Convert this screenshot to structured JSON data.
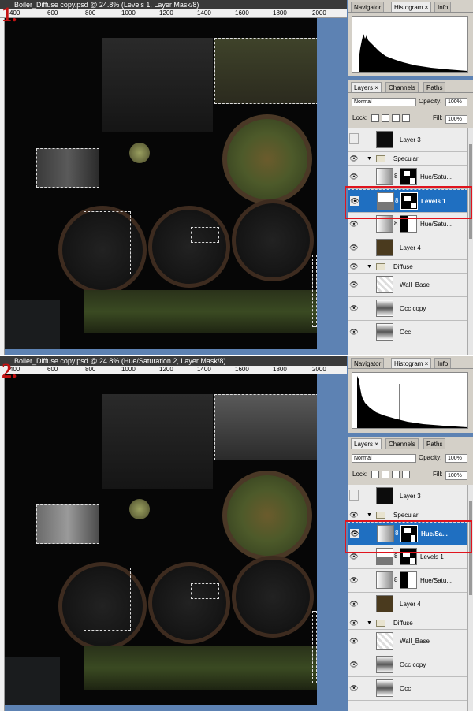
{
  "step1": {
    "number": "1.",
    "window_title": "Boiler_Diffuse copy.psd @ 24.8% (Levels 1, Layer Mask/8)",
    "ruler_labels": [
      "400",
      "600",
      "800",
      "1000",
      "1200",
      "1400",
      "1600",
      "1800",
      "2000"
    ],
    "panel_tabs": [
      "Navigator",
      "Histogram",
      "Info"
    ],
    "active_panel_tab": "Histogram",
    "layers_tabs": [
      "Layers",
      "Channels",
      "Paths"
    ],
    "blend_mode": "Normal",
    "opacity_label": "Opacity:",
    "opacity_value": "100%",
    "lock_label": "Lock:",
    "fill_label": "Fill:",
    "fill_value": "100%",
    "layers": [
      {
        "name": "Layer 3",
        "kind": "pixel",
        "visible": false
      },
      {
        "name": "Specular",
        "kind": "group",
        "visible": true
      },
      {
        "name": "Hue/Satu...",
        "kind": "adjust",
        "visible": true
      },
      {
        "name": "Levels 1",
        "kind": "adjust",
        "visible": true,
        "selected": true
      },
      {
        "name": "Hue/Satu...",
        "kind": "adjust",
        "visible": true
      },
      {
        "name": "Layer 4",
        "kind": "pixel",
        "visible": true
      },
      {
        "name": "Diffuse",
        "kind": "group",
        "visible": true
      },
      {
        "name": "Wall_Base",
        "kind": "pixel",
        "visible": true
      },
      {
        "name": "Occ copy",
        "kind": "pixel",
        "visible": true
      },
      {
        "name": "Occ",
        "kind": "pixel",
        "visible": true
      }
    ]
  },
  "step2": {
    "number": "2.",
    "window_title": "Boiler_Diffuse copy.psd @ 24.8% (Hue/Saturation 2, Layer Mask/8)",
    "ruler_labels": [
      "400",
      "600",
      "800",
      "1000",
      "1200",
      "1400",
      "1600",
      "1800",
      "2000"
    ],
    "panel_tabs": [
      "Navigator",
      "Histogram",
      "Info"
    ],
    "active_panel_tab": "Histogram",
    "layers_tabs": [
      "Layers",
      "Channels",
      "Paths"
    ],
    "blend_mode": "Normal",
    "opacity_label": "Opacity:",
    "opacity_value": "100%",
    "lock_label": "Lock:",
    "fill_label": "Fill:",
    "fill_value": "100%",
    "layers": [
      {
        "name": "Layer 3",
        "kind": "pixel",
        "visible": false
      },
      {
        "name": "Specular",
        "kind": "group",
        "visible": true
      },
      {
        "name": "Hue/Sa...",
        "kind": "adjust",
        "visible": true,
        "selected": true
      },
      {
        "name": "Levels 1",
        "kind": "adjust",
        "visible": true
      },
      {
        "name": "Hue/Satu...",
        "kind": "adjust",
        "visible": true
      },
      {
        "name": "Layer 4",
        "kind": "pixel",
        "visible": true
      },
      {
        "name": "Diffuse",
        "kind": "group",
        "visible": true
      },
      {
        "name": "Wall_Base",
        "kind": "pixel",
        "visible": true
      },
      {
        "name": "Occ copy",
        "kind": "pixel",
        "visible": true
      },
      {
        "name": "Occ",
        "kind": "pixel",
        "visible": true
      }
    ]
  },
  "colors": {
    "highlight_box": "#e0141e",
    "selected_layer": "#1f6fc1",
    "step_number": "#c41212"
  }
}
